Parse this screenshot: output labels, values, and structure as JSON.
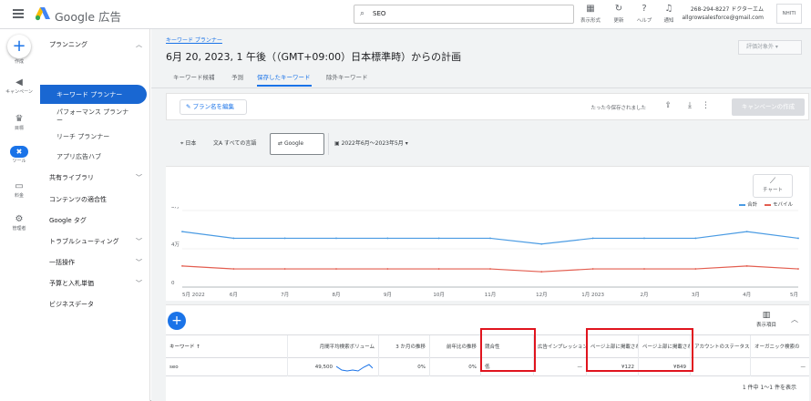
{
  "header": {
    "brand": "Google 広告",
    "search_value": "SEO",
    "buttons": [
      {
        "icon": "display-icon",
        "label": "表示形式"
      },
      {
        "icon": "refresh-icon",
        "label": "更新"
      },
      {
        "icon": "help-icon",
        "label": "ヘルプ"
      },
      {
        "icon": "bell-icon",
        "label": "通知"
      }
    ],
    "account_id": "268-294-8227 ドクターエム",
    "account_email": "allgrowsalesforce@gmail.com",
    "avatar_text": "NHITI"
  },
  "rail": [
    {
      "icon": "create-icon",
      "label": "作成"
    },
    {
      "icon": "campaign-icon",
      "label": "キャンペーン"
    },
    {
      "icon": "goals-icon",
      "label": "目標"
    },
    {
      "icon": "tools-icon",
      "label": "ツール"
    },
    {
      "icon": "billing-icon",
      "label": "料金"
    },
    {
      "icon": "admin-icon",
      "label": "管理者"
    }
  ],
  "sidenav": {
    "planning": "プランニング",
    "active": "キーワード プランナー",
    "performance_planner": "パフォーマンス プランナー",
    "reach_planner": "リーチ プランナー",
    "app_hub": "アプリ広告ハブ",
    "shared_library": "共有ライブラリ",
    "content_suitability": "コンテンツの適合性",
    "google_tag": "Google タグ",
    "troubleshooting": "トラブルシューティング",
    "bulk_actions": "一括操作",
    "budgets_bidding": "予算と入札単価",
    "business_data": "ビジネスデータ"
  },
  "main": {
    "breadcrumb": "キーワード プランナー",
    "title": "6月 20, 2023, 1 午後（（GMT+09:00）日本標準時）からの計画",
    "scope": "評価対象外",
    "tabs": [
      "キーワード候補",
      "予測",
      "保存したキーワード",
      "除外キーワード"
    ],
    "edit_plan": "プラン名を編集",
    "saved_text": "たった今保存されました",
    "create_campaign": "キャンペーンの作成",
    "filters": {
      "location": "日本",
      "language": "すべての言語",
      "network": "Google",
      "date_range": "2022年6月～2023年5月"
    }
  },
  "chart_data": {
    "type": "line",
    "x": [
      "5月 2022",
      "6月",
      "7月",
      "8月",
      "9月",
      "10月",
      "11月",
      "12月",
      "1月 2023",
      "2月",
      "3月",
      "4月",
      "5月"
    ],
    "series": [
      {
        "name": "合計",
        "color": "#4a9be3",
        "values": [
          58000,
          51000,
          51000,
          51000,
          51000,
          51000,
          51000,
          45000,
          51000,
          51000,
          51000,
          58000,
          51000
        ]
      },
      {
        "name": "モバイル",
        "color": "#e35d4f",
        "values": [
          22000,
          19000,
          19000,
          19000,
          19000,
          19000,
          19000,
          16000,
          19000,
          19000,
          19000,
          22000,
          19000
        ]
      }
    ],
    "yticks": [
      "0",
      "4万",
      "8万"
    ],
    "ylim": [
      0,
      80000
    ],
    "button_label": "チャート",
    "legend_position": "top-right"
  },
  "table": {
    "columns_button": "表示項目",
    "headers": [
      "キーワード ↑",
      "月間平均検索ボリューム",
      "3 か月の推移",
      "前年比の推移",
      "競合性",
      "広告インプレッション シェア",
      "ページ上部に掲載された広告の入札単価（低額帯）",
      "ページ上部に掲載された広告の入札単価（高額帯）",
      "アカウントのステータス",
      "オーガニック検索の"
    ],
    "rows": [
      {
        "keyword": "seo",
        "volume": "49,500",
        "three_month": "0%",
        "yoy": "0%",
        "competition": "低",
        "impression_share": "—",
        "bid_low": "¥122",
        "bid_high": "¥849",
        "account_status": "",
        "organic": "—"
      }
    ],
    "pager": "1 件中 1～1 件を表示"
  }
}
